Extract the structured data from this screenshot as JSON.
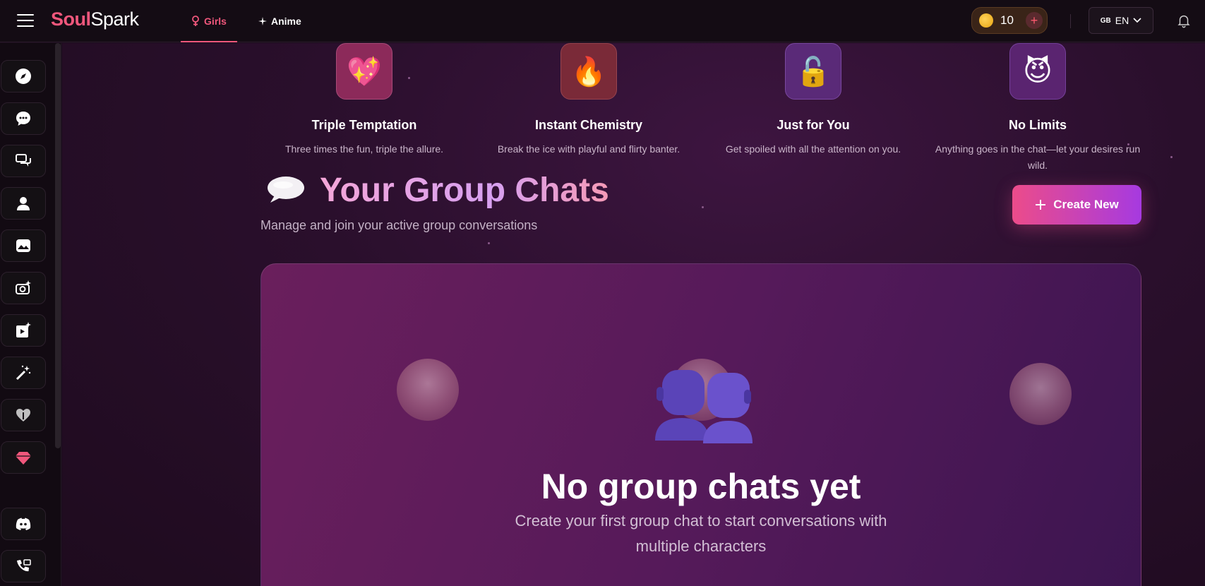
{
  "header": {
    "logo_part1": "Soul",
    "logo_part2": "Spark",
    "tabs": [
      {
        "label": "Girls",
        "icon": "female-icon",
        "active": true
      },
      {
        "label": "Anime",
        "icon": "sparkle-icon",
        "active": false
      }
    ],
    "coins": "10",
    "lang_flag": "GB",
    "lang_code": "EN"
  },
  "sidebar": {
    "items": [
      {
        "name": "explore",
        "icon": "compass-icon"
      },
      {
        "name": "chat",
        "icon": "chat-bubble-icon"
      },
      {
        "name": "group-chat",
        "icon": "group-chat-icon"
      },
      {
        "name": "characters",
        "icon": "user-icon"
      },
      {
        "name": "gallery",
        "icon": "image-icon"
      },
      {
        "name": "generate",
        "icon": "camera-spark-icon"
      },
      {
        "name": "video",
        "icon": "video-spark-icon"
      },
      {
        "name": "create",
        "icon": "magic-wand-icon"
      },
      {
        "name": "companions",
        "icon": "heart-hands-icon"
      },
      {
        "name": "premium",
        "icon": "diamond-icon"
      },
      {
        "name": "discord",
        "icon": "discord-icon"
      },
      {
        "name": "support",
        "icon": "support-icon"
      }
    ]
  },
  "features": [
    {
      "title": "Triple Temptation",
      "desc": "Three times the fun, triple the allure.",
      "icon": "sparkling-heart-icon",
      "emoji": "💖"
    },
    {
      "title": "Instant Chemistry",
      "desc": "Break the ice with playful and flirty banter.",
      "icon": "fire-icon",
      "emoji": "🔥"
    },
    {
      "title": "Just for You",
      "desc": "Get spoiled with all the attention on you.",
      "icon": "unlock-icon",
      "emoji": "🔓"
    },
    {
      "title": "No Limits",
      "desc": "Anything goes in the chat—let your desires run wild.",
      "icon": "devil-icon",
      "emoji": "😈"
    }
  ],
  "group_chats": {
    "title": "Your Group Chats",
    "subtitle": "Manage and join your active group conversations",
    "create_label": "Create New"
  },
  "empty_state": {
    "title": "No group chats yet",
    "desc_line1": "Create your first group chat to start conversations with",
    "desc_line2": "multiple characters"
  },
  "colors": {
    "accent": "#f0577c",
    "button_gradient_start": "#ec4c8a",
    "button_gradient_end": "#a63ae0"
  }
}
